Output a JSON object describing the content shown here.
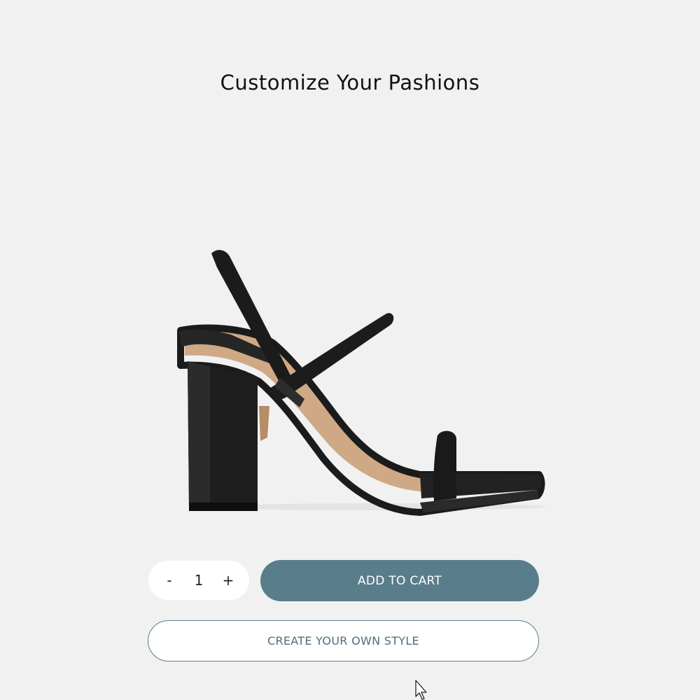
{
  "header": {
    "title": "Customize Your Pashions"
  },
  "product": {
    "image_icon": "strappy-block-heel-sandal-image",
    "colors": {
      "leather": "#1b1b1b",
      "insole": "#cfa985",
      "background": "#f1f1f1"
    }
  },
  "quantity": {
    "decrement_label": "-",
    "value": "1",
    "increment_label": "+"
  },
  "actions": {
    "add_to_cart_label": "ADD TO CART",
    "create_style_label": "CREATE YOUR OWN STYLE"
  },
  "theme": {
    "accent": "#597d8b",
    "accent_text": "#4f6f7b"
  }
}
